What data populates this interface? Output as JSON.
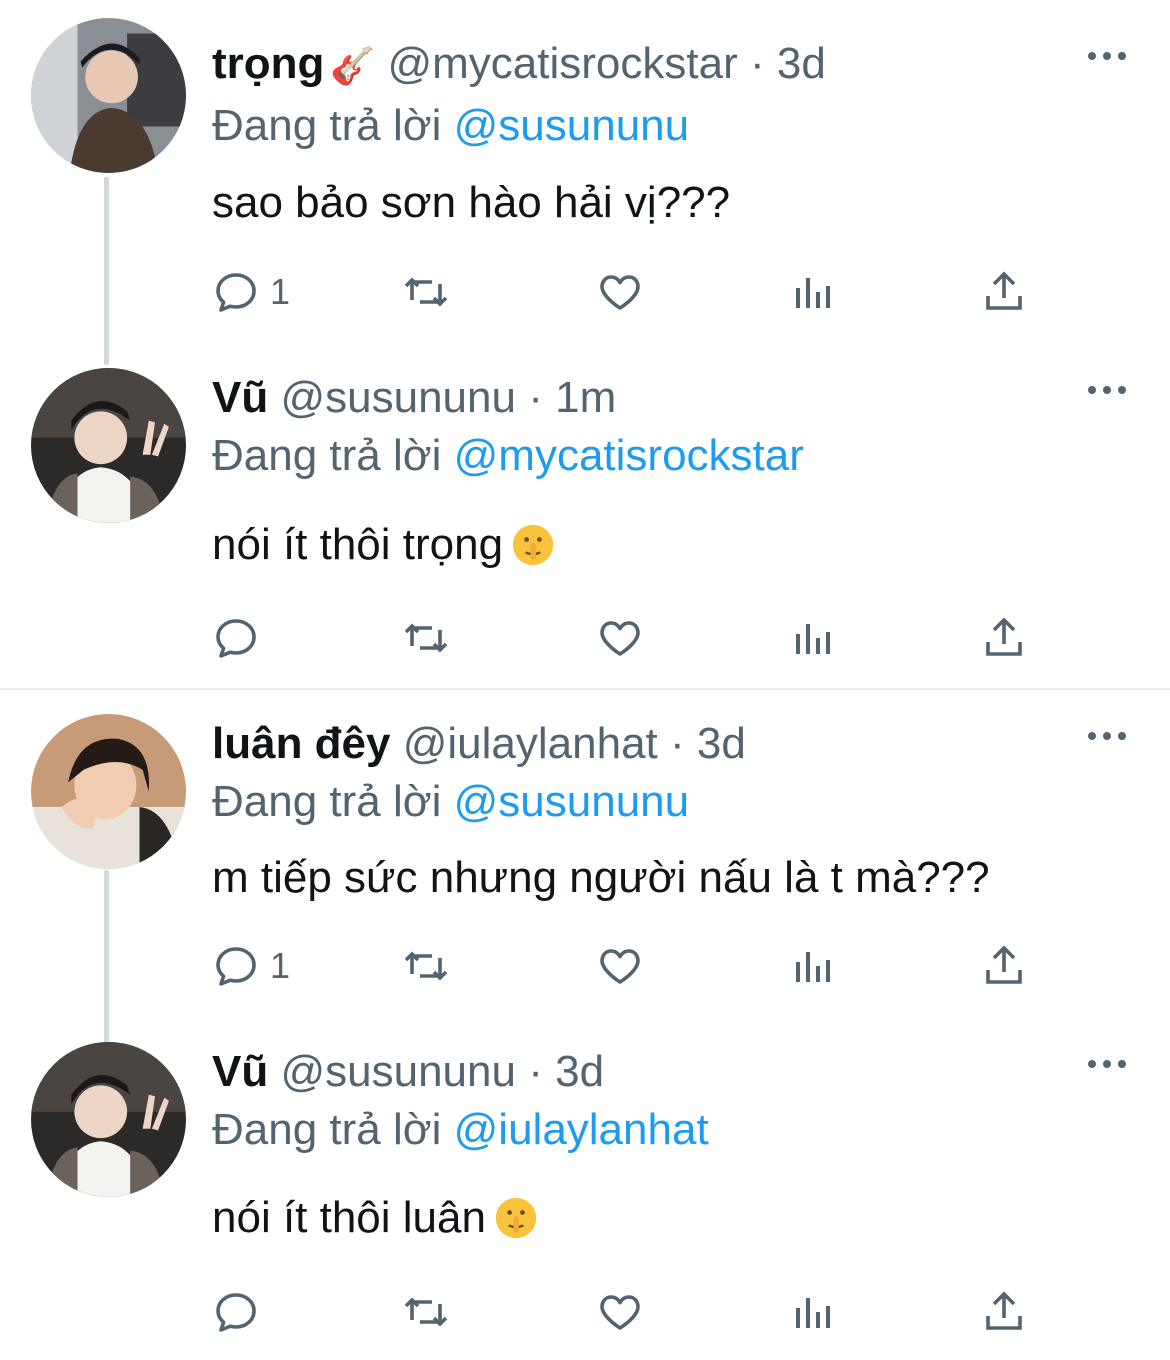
{
  "tweets": [
    {
      "name": "trọng",
      "name_emoji": "🎸",
      "handle": "@mycatisrockstar",
      "dot": "·",
      "time": "3d",
      "replying_prefix": "Đang trả lời",
      "replying_to": "@susununu",
      "text": "sao bảo sơn hào hải vị???",
      "reply_count": "1"
    },
    {
      "name": "Vũ",
      "handle": "@susununu",
      "dot": "·",
      "time": "1m",
      "replying_prefix": "Đang trả lời",
      "replying_to": "@mycatisrockstar",
      "text": "nói ít thôi trọng",
      "reply_count": ""
    },
    {
      "name": "luân đêy",
      "handle": "@iulaylanhat",
      "dot": "·",
      "time": "3d",
      "replying_prefix": "Đang trả lời",
      "replying_to": "@susununu",
      "text": "m tiếp sức nhưng người nấu là t mà???",
      "reply_count": "1"
    },
    {
      "name": "Vũ",
      "handle": "@susununu",
      "dot": "·",
      "time": "3d",
      "replying_prefix": "Đang trả lời",
      "replying_to": "@iulaylanhat",
      "text": "nói ít thôi luân",
      "reply_count": ""
    }
  ],
  "icons": {
    "reply": "reply-icon",
    "retweet": "retweet-icon",
    "like": "heart-icon",
    "views": "analytics-icon",
    "share": "share-icon",
    "more": "more-icon",
    "emoji_text": "shushing-face-emoji"
  },
  "colors": {
    "text": "#0f1419",
    "secondary": "#536471",
    "link": "#1d9bf0",
    "connector": "#cfd9de",
    "divider": "#e6ecf0"
  }
}
